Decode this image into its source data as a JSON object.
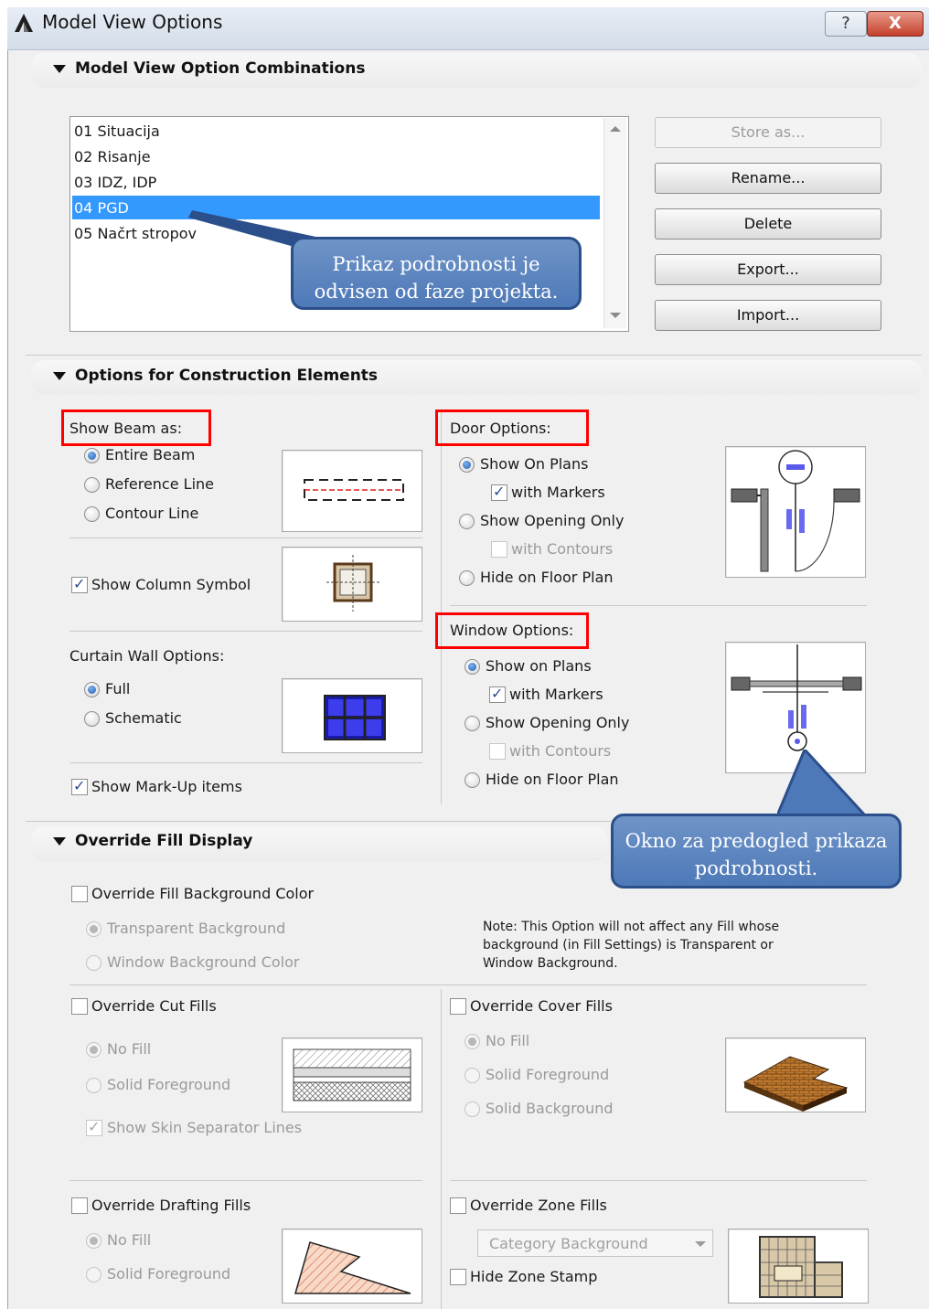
{
  "window": {
    "title": "Model View Options",
    "help_label": "?",
    "close_label": "X"
  },
  "combinations": {
    "header": "Model View Option Combinations",
    "items": [
      "01 Situacija",
      "02 Risanje",
      "03 IDZ, IDP",
      "04 PGD",
      "05 Načrt stropov"
    ],
    "selected_index": 3,
    "buttons": {
      "store": "Store as...",
      "rename": "Rename...",
      "delete": "Delete",
      "export": "Export...",
      "import": "Import..."
    },
    "callout": "Prikaz podrobnosti je odvisen od faze projekta."
  },
  "construction": {
    "header": "Options for Construction Elements",
    "beam": {
      "label": "Show Beam as:",
      "options": [
        "Entire Beam",
        "Reference Line",
        "Contour Line"
      ],
      "selected": 0
    },
    "column": {
      "label": "Show Column Symbol",
      "checked": true
    },
    "curtain": {
      "label": "Curtain Wall Options:",
      "options": [
        "Full",
        "Schematic"
      ],
      "selected": 0
    },
    "markup": {
      "label": "Show Mark-Up items",
      "checked": true
    },
    "door": {
      "label": "Door Options:",
      "show_on_plans": "Show On Plans",
      "with_markers": "with Markers",
      "show_opening_only": "Show Opening Only",
      "with_contours": "with Contours",
      "hide_on_floor_plan": "Hide on Floor Plan"
    },
    "window_opts": {
      "label": "Window Options:",
      "show_on_plans": "Show on Plans",
      "with_markers": "with Markers",
      "show_opening_only": "Show Opening Only",
      "with_contours": "with Contours",
      "hide_on_floor_plan": "Hide on Floor Plan"
    },
    "preview_callout": "Okno za predogled prikaza podrobnosti."
  },
  "fill": {
    "header": "Override Fill Display",
    "bg_color": {
      "label": "Override Fill Background Color",
      "options": [
        "Transparent Background",
        "Window Background Color"
      ]
    },
    "note": "Note: This Option will not affect any Fill whose background (in Fill Settings) is Transparent or Window Background.",
    "cut": {
      "label": "Override Cut Fills",
      "options": [
        "No Fill",
        "Solid Foreground"
      ],
      "skin": "Show Skin Separator Lines"
    },
    "cover": {
      "label": "Override Cover Fills",
      "options": [
        "No Fill",
        "Solid Foreground",
        "Solid Background"
      ]
    },
    "drafting": {
      "label": "Override Drafting Fills",
      "options": [
        "No Fill",
        "Solid Foreground"
      ]
    },
    "zone": {
      "label": "Override Zone Fills",
      "dropdown": "Category Background",
      "hide_stamp": "Hide Zone Stamp"
    }
  },
  "colors": {
    "selection": "#3399ff",
    "highlight_red": "#ff0000",
    "callout_blue": "#4e79b8"
  }
}
